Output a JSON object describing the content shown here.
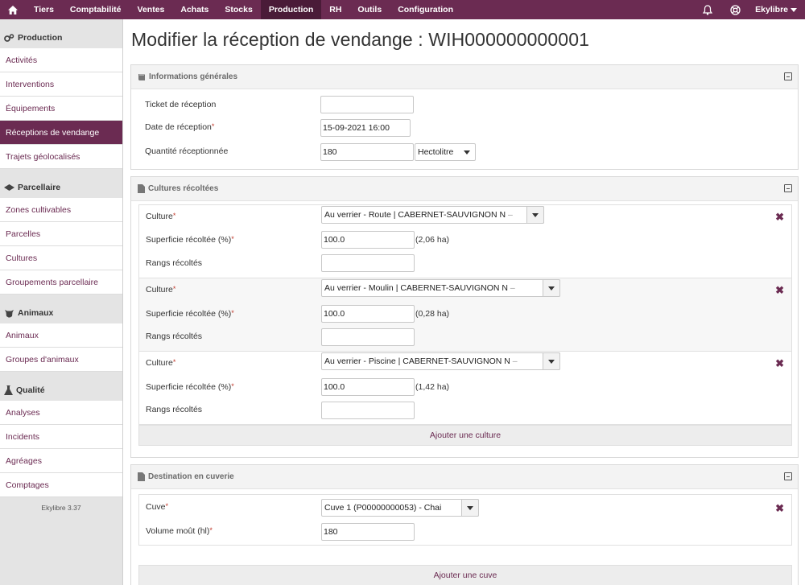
{
  "topnav": {
    "items": [
      "Tiers",
      "Comptabilité",
      "Ventes",
      "Achats",
      "Stocks",
      "Production",
      "RH",
      "Outils",
      "Configuration"
    ],
    "active": "Production",
    "user": "Ekylibre"
  },
  "sidebar": {
    "sections": [
      {
        "title": "Production",
        "icon": "gears-icon",
        "items": [
          "Activités",
          "Interventions",
          "Équipements",
          "Réceptions de vendange",
          "Trajets géolocalisés"
        ]
      },
      {
        "title": "Parcellaire",
        "icon": "map-icon",
        "items": [
          "Zones cultivables",
          "Parcelles",
          "Cultures",
          "Groupements parcellaire"
        ]
      },
      {
        "title": "Animaux",
        "icon": "cow-icon",
        "items": [
          "Animaux",
          "Groupes d'animaux"
        ]
      },
      {
        "title": "Qualité",
        "icon": "flask-icon",
        "items": [
          "Analyses",
          "Incidents",
          "Agréages",
          "Comptages"
        ]
      }
    ],
    "active_item": "Réceptions de vendange",
    "version": "Ekylibre 3.37"
  },
  "page": {
    "title": "Modifier la réception de vendange : WIH000000000001"
  },
  "general": {
    "title": "Informations générales",
    "ticket_label": "Ticket de réception",
    "ticket_value": "",
    "date_label": "Date de réception",
    "date_value": "15-09-2021 16:00",
    "quantity_label": "Quantité réceptionnée",
    "quantity_value": "180",
    "unit_value": "Hectolitre"
  },
  "cultures": {
    "title": "Cultures récoltées",
    "culture_label": "Culture",
    "area_label": "Superficie récoltée (%)",
    "rows_label": "Rangs récoltés",
    "items": [
      {
        "culture": "Au verrier - Route | CABERNET-SAUVIGNON N",
        "area_pct": "100.0",
        "area_ha": "(2,06 ha)",
        "rows": ""
      },
      {
        "culture": "Au verrier - Moulin | CABERNET-SAUVIGNON N",
        "area_pct": "100.0",
        "area_ha": "(0,28 ha)",
        "rows": ""
      },
      {
        "culture": "Au verrier - Piscine | CABERNET-SAUVIGNON N",
        "area_pct": "100.0",
        "area_ha": "(1,42 ha)",
        "rows": ""
      }
    ],
    "add_label": "Ajouter une culture"
  },
  "storage": {
    "title": "Destination en cuverie",
    "tank_label": "Cuve",
    "tank_value": "Cuve 1 (P00000000053) - Chai",
    "volume_label": "Volume moût (hl)",
    "volume_value": "180",
    "add_label": "Ajouter une cuve"
  },
  "required_mark": "*"
}
